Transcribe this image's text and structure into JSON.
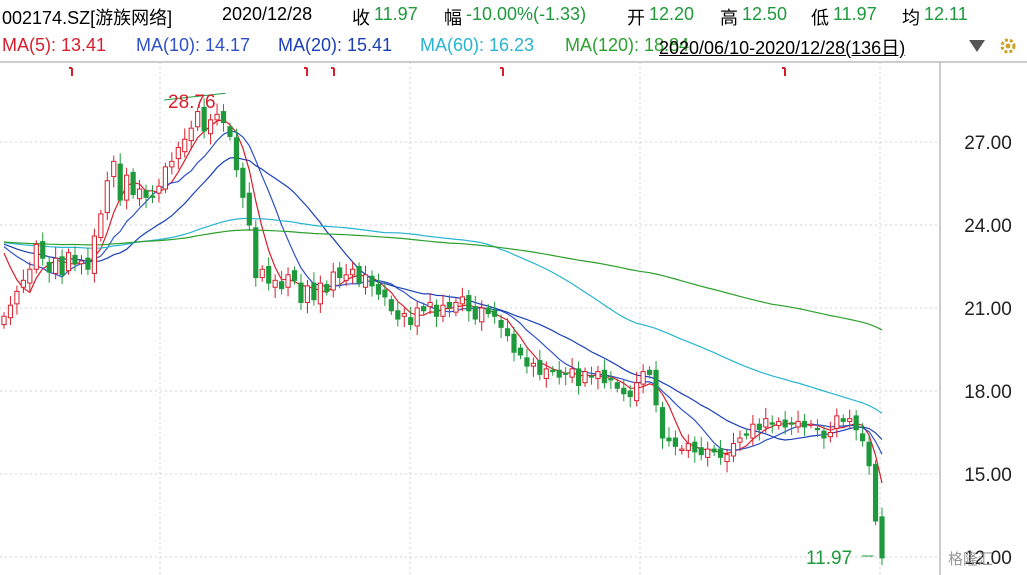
{
  "header": {
    "code": "002174.SZ[游族网络]",
    "date": "2020/12/28",
    "close_label": "收",
    "close_value": "11.97",
    "change_label": "幅",
    "change_value": "-10.00%(-1.33)",
    "open_label": "开",
    "open_value": "12.20",
    "high_label": "高",
    "high_value": "12.50",
    "low_label": "低",
    "low_value": "11.97",
    "avg_label": "均",
    "avg_value": "12.11"
  },
  "ma_legend": [
    {
      "text": "MA(5): 13.41",
      "color": "#d81e2c"
    },
    {
      "text": "MA(10): 14.17",
      "color": "#2e51c8"
    },
    {
      "text": "MA(20): 15.41",
      "color": "#1a3fb5"
    },
    {
      "text": "MA(60): 16.23",
      "color": "#28b4d2"
    },
    {
      "text": "MA(120): 18.84",
      "color": "#2ca02c"
    }
  ],
  "range_text": "2020/06/10-2020/12/28(136日)",
  "watermark": "格隆汇",
  "colors": {
    "up": "#d81e2c",
    "down": "#1e9a3c",
    "grid": "#d0d0d0"
  },
  "chart_data": {
    "type": "candlestick",
    "title": "",
    "xlabel": "",
    "ylabel": "",
    "ylim": [
      11.5,
      29.0
    ],
    "yticks": [
      "27.00",
      "24.00",
      "21.00",
      "18.00",
      "15.00",
      "12.00"
    ],
    "ytick_values": [
      27,
      24,
      21,
      18,
      15,
      12
    ],
    "grid": true,
    "annotations": {
      "high": {
        "text": "28.76",
        "value": 28.76,
        "index": 34
      },
      "last": {
        "text": "11.97",
        "value": 11.97,
        "index": 135
      }
    },
    "event_marker_indices": [
      17,
      73,
      80,
      120,
      188
    ],
    "closes": [
      20.7,
      21.1,
      21.6,
      22.0,
      22.4,
      23.3,
      22.8,
      22.3,
      22.8,
      22.2,
      23.0,
      22.6,
      22.7,
      22.4,
      23.6,
      24.4,
      25.6,
      26.3,
      24.9,
      25.8,
      25.1,
      25.3,
      25.0,
      25.0,
      25.4,
      26.1,
      26.3,
      26.8,
      27.1,
      27.5,
      28.1,
      27.4,
      27.8,
      28.0,
      27.7,
      27.2,
      26.0,
      25.0,
      24.0,
      22.1,
      22.4,
      21.9,
      22.0,
      21.7,
      22.2,
      22.0,
      21.2,
      21.8,
      21.3,
      21.9,
      21.6,
      22.3,
      22.1,
      22.2,
      22.4,
      21.9,
      22.2,
      21.8,
      21.5,
      21.4,
      20.9,
      20.6,
      20.8,
      20.4,
      21.0,
      20.9,
      21.2,
      20.7,
      21.1,
      21.0,
      21.2,
      21.4,
      20.9,
      20.6,
      21.0,
      20.8,
      20.7,
      20.3,
      20.0,
      19.4,
      19.3,
      18.9,
      19.0,
      18.6,
      18.8,
      18.7,
      18.5,
      18.6,
      18.8,
      18.2,
      18.7,
      18.5,
      18.7,
      18.3,
      18.4,
      18.1,
      17.9,
      17.8,
      18.3,
      18.7,
      18.6,
      17.5,
      16.3,
      16.2,
      16.0,
      15.9,
      16.1,
      15.8,
      15.7,
      15.9,
      15.8,
      15.6,
      15.7,
      16.1,
      16.3,
      16.4,
      16.8,
      16.6,
      17.0,
      16.8,
      16.9,
      16.7,
      16.8,
      16.9,
      16.7,
      16.8,
      16.6,
      16.3,
      16.5,
      17.1,
      16.9,
      17.0,
      16.6,
      16.2,
      15.3,
      13.3,
      11.97
    ],
    "series": [
      {
        "name": "MA(5)",
        "color": "#d81e2c"
      },
      {
        "name": "MA(10)",
        "color": "#2e51c8"
      },
      {
        "name": "MA(20)",
        "color": "#1a3fb5"
      },
      {
        "name": "MA(60)",
        "color": "#28b4d2"
      },
      {
        "name": "MA(120)",
        "color": "#2ca02c"
      }
    ]
  }
}
